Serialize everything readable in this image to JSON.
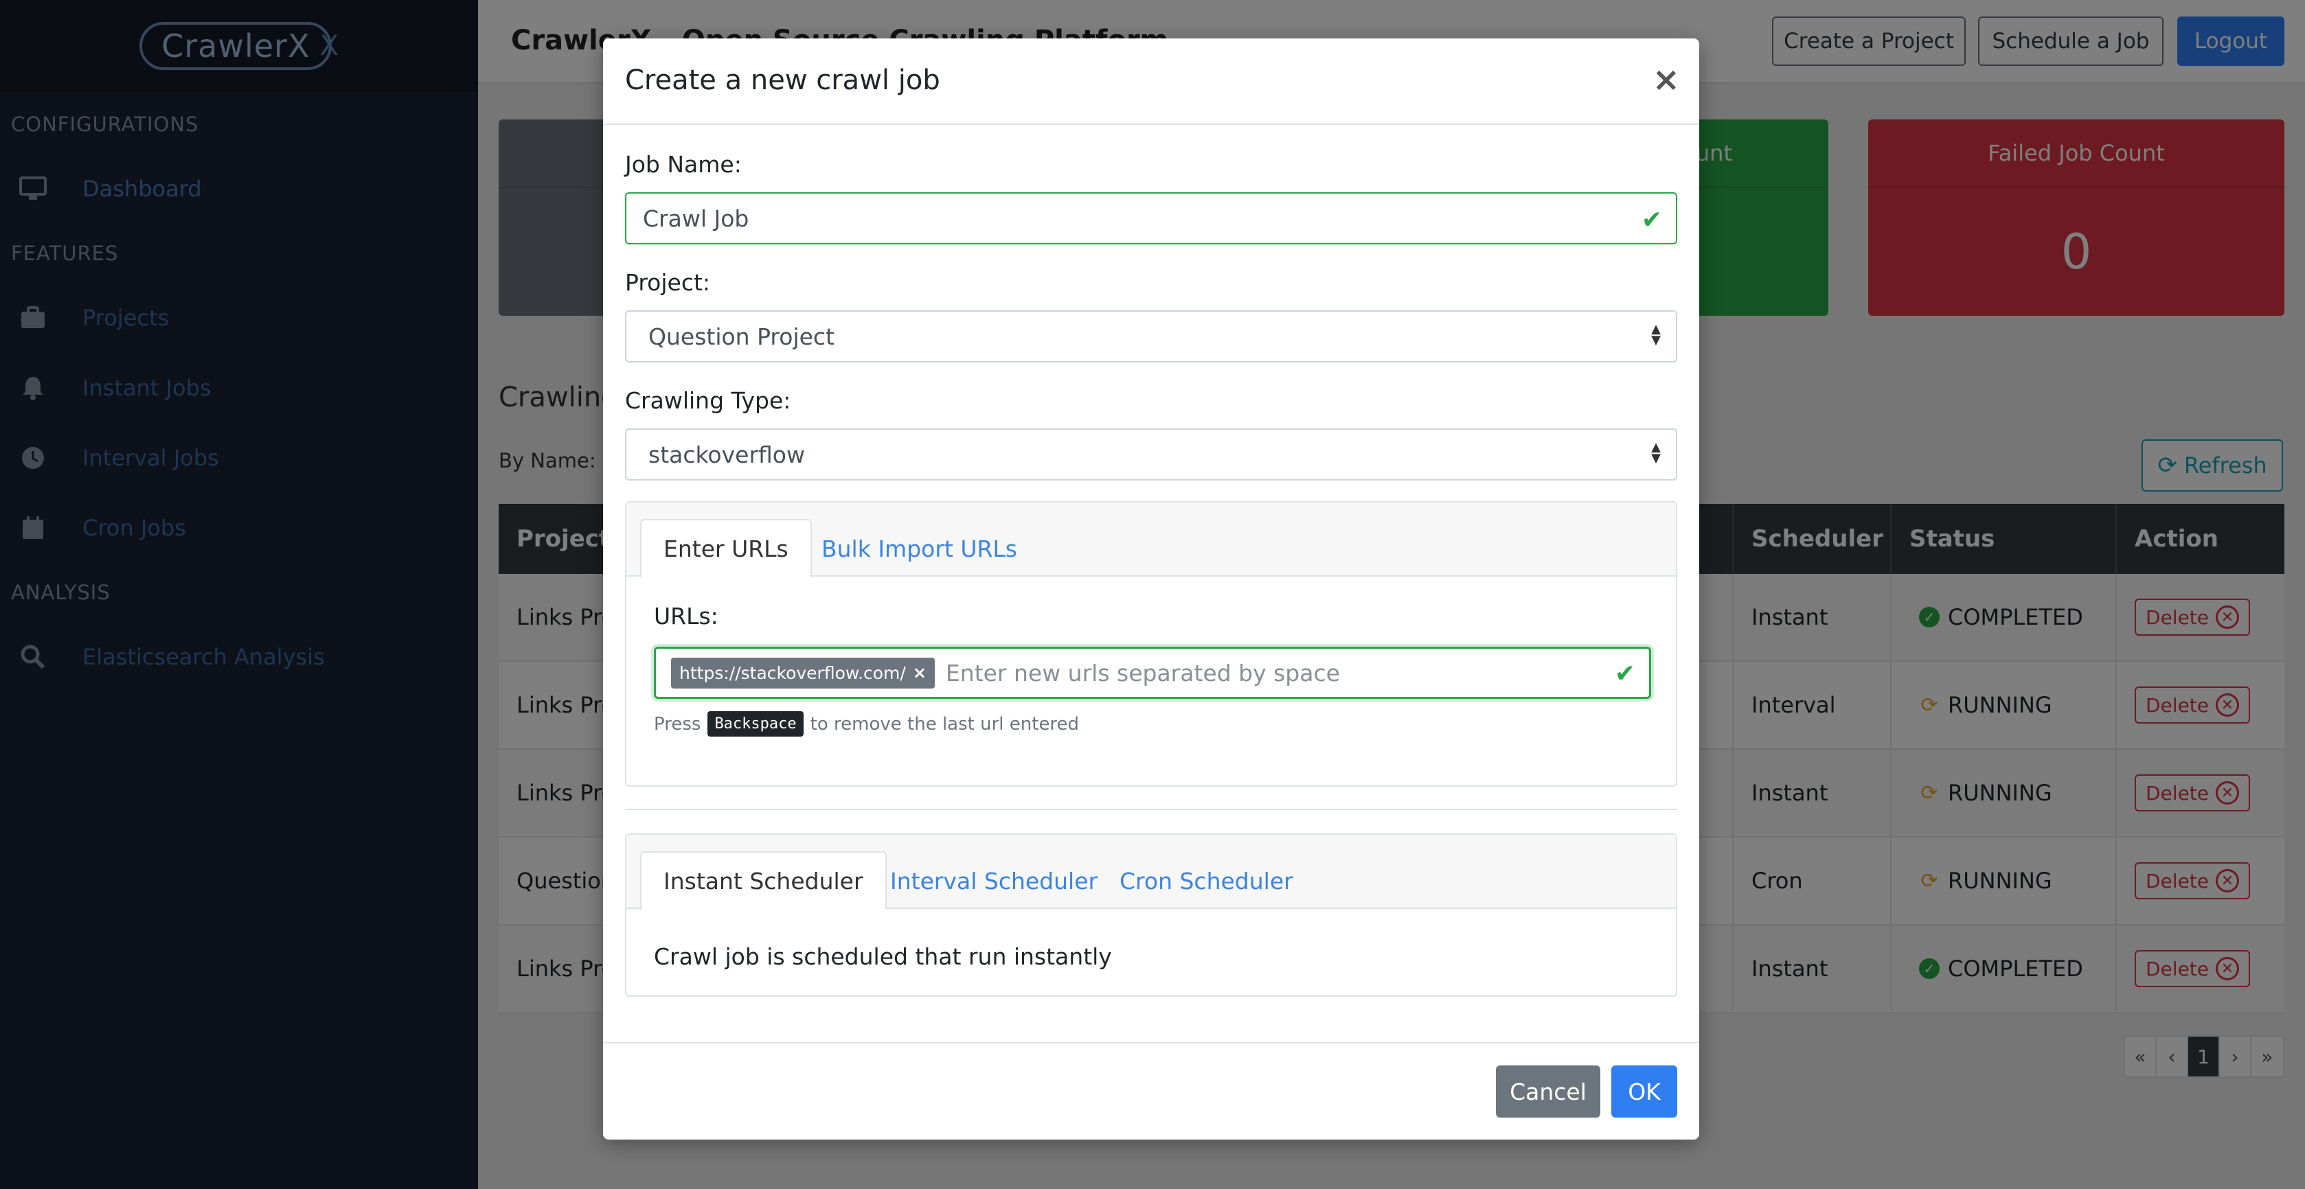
{
  "sidebar": {
    "logo_text": "CrawlerX",
    "logo_mark": "X",
    "sections": {
      "configurations": "CONFIGURATIONS",
      "features": "FEATURES",
      "analysis": "ANALYSIS"
    },
    "items": {
      "dashboard": "Dashboard",
      "projects": "Projects",
      "instant_jobs": "Instant Jobs",
      "interval_jobs": "Interval Jobs",
      "cron_jobs": "Cron Jobs",
      "elasticsearch": "Elasticsearch Analysis"
    }
  },
  "topbar": {
    "brand": "CrawlerX - Open Source Crawling Platform",
    "create_project": "Create a Project",
    "schedule_job": "Schedule a Job",
    "logout": "Logout"
  },
  "stats": {
    "left_label": "",
    "left_value": "",
    "middle_label": "unt",
    "middle_value": "",
    "failed_label": "Failed Job Count",
    "failed_value": "0"
  },
  "dashboard": {
    "section_title": "Crawling Jobs",
    "by_name": "By Name:",
    "refresh": "Refresh"
  },
  "table": {
    "headers": {
      "project": "Project Name",
      "scheduler": "Scheduler",
      "status": "Status",
      "action": "Action"
    },
    "rows": [
      {
        "project": "Links Project",
        "scheduler": "Instant",
        "status": "COMPLETED",
        "action": "Delete"
      },
      {
        "project": "Links Project",
        "scheduler": "Interval",
        "status": "RUNNING",
        "action": "Delete"
      },
      {
        "project": "Links Project",
        "scheduler": "Instant",
        "status": "RUNNING",
        "action": "Delete"
      },
      {
        "project": "Question Project",
        "scheduler": "Cron",
        "status": "RUNNING",
        "action": "Delete"
      },
      {
        "project": "Links Project",
        "scheduler": "Instant",
        "status": "COMPLETED",
        "action": "Delete"
      }
    ]
  },
  "pager": {
    "first": "«",
    "prev": "‹",
    "current": "1",
    "next": "›",
    "last": "»"
  },
  "modal": {
    "title": "Create a new crawl job",
    "close": "×",
    "job_name_label": "Job Name:",
    "job_name_value": "Crawl Job",
    "project_label": "Project:",
    "project_value": "Question Project",
    "crawling_type_label": "Crawling Type:",
    "crawling_type_value": "stackoverflow",
    "url_tabs": {
      "enter": "Enter URLs",
      "bulk": "Bulk Import URLs"
    },
    "urls_label": "URLs:",
    "url_tag": "https://stackoverflow.com/",
    "url_tag_remove": "×",
    "url_placeholder": "Enter new urls separated by space",
    "hint_before": "Press",
    "hint_key": "Backspace",
    "hint_after": "to remove the last url entered",
    "scheduler_tabs": {
      "instant": "Instant Scheduler",
      "interval": "Interval Scheduler",
      "cron": "Cron Scheduler"
    },
    "scheduler_desc": "Crawl job is scheduled that run instantly",
    "cancel": "Cancel",
    "ok": "OK"
  }
}
